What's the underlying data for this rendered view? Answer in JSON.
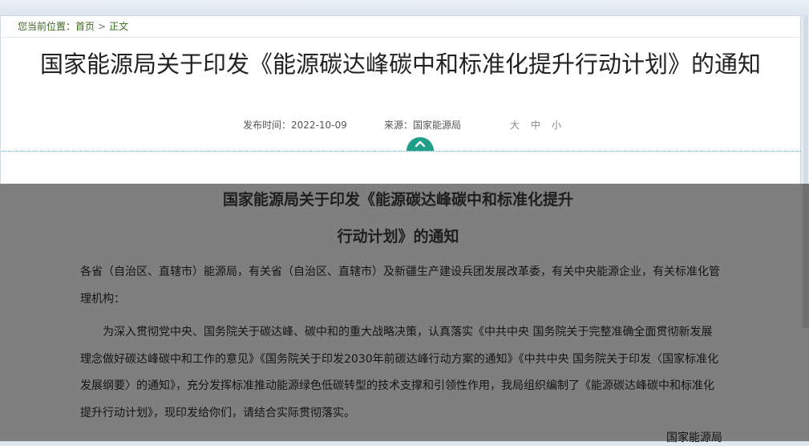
{
  "breadcrumb": {
    "prefix": "您当前位置：",
    "home": "首页",
    "separator": ">",
    "current": "正文"
  },
  "article": {
    "title": "国家能源局关于印发《能源碳达峰碳中和标准化提升行动计划》的通知",
    "date_label": "发布时间：2022-10-09",
    "source_label": "来源：国家能源局",
    "font_sizes": [
      "大",
      "中",
      "小"
    ]
  },
  "document": {
    "title_line1": "国家能源局关于印发《能源碳达峰碳中和标准化提升",
    "title_line2": "行动计划》的通知",
    "addressee": "各省（自治区、直辖市）能源局，有关省（自治区、直辖市）及新疆生产建设兵团发展改革委，有关中央能源企业，有关标准化管理机构：",
    "body": "为深入贯彻党中央、国务院关于碳达峰、碳中和的重大战略决策，认真落实《中共中央 国务院关于完整准确全面贯彻新发展理念做好碳达峰碳中和工作的意见》《国务院关于印发2030年前碳达峰行动方案的通知》《中共中央 国务院关于印发〈国家标准化发展纲要〉的通知》，充分发挥标准推动能源绿色低碳转型的技术支撑和引领性作用，我局组织编制了《能源碳达峰碳中和标准化提升行动计划》，现印发给你们，请结合实际贯彻落实。",
    "signature": "国家能源局"
  },
  "icons": {
    "collapse": "chevron-up-icon"
  },
  "colors": {
    "accent": "#1f9e8a",
    "breadcrumb": "#3a6a1f",
    "overlay": "#7f7f7f"
  }
}
